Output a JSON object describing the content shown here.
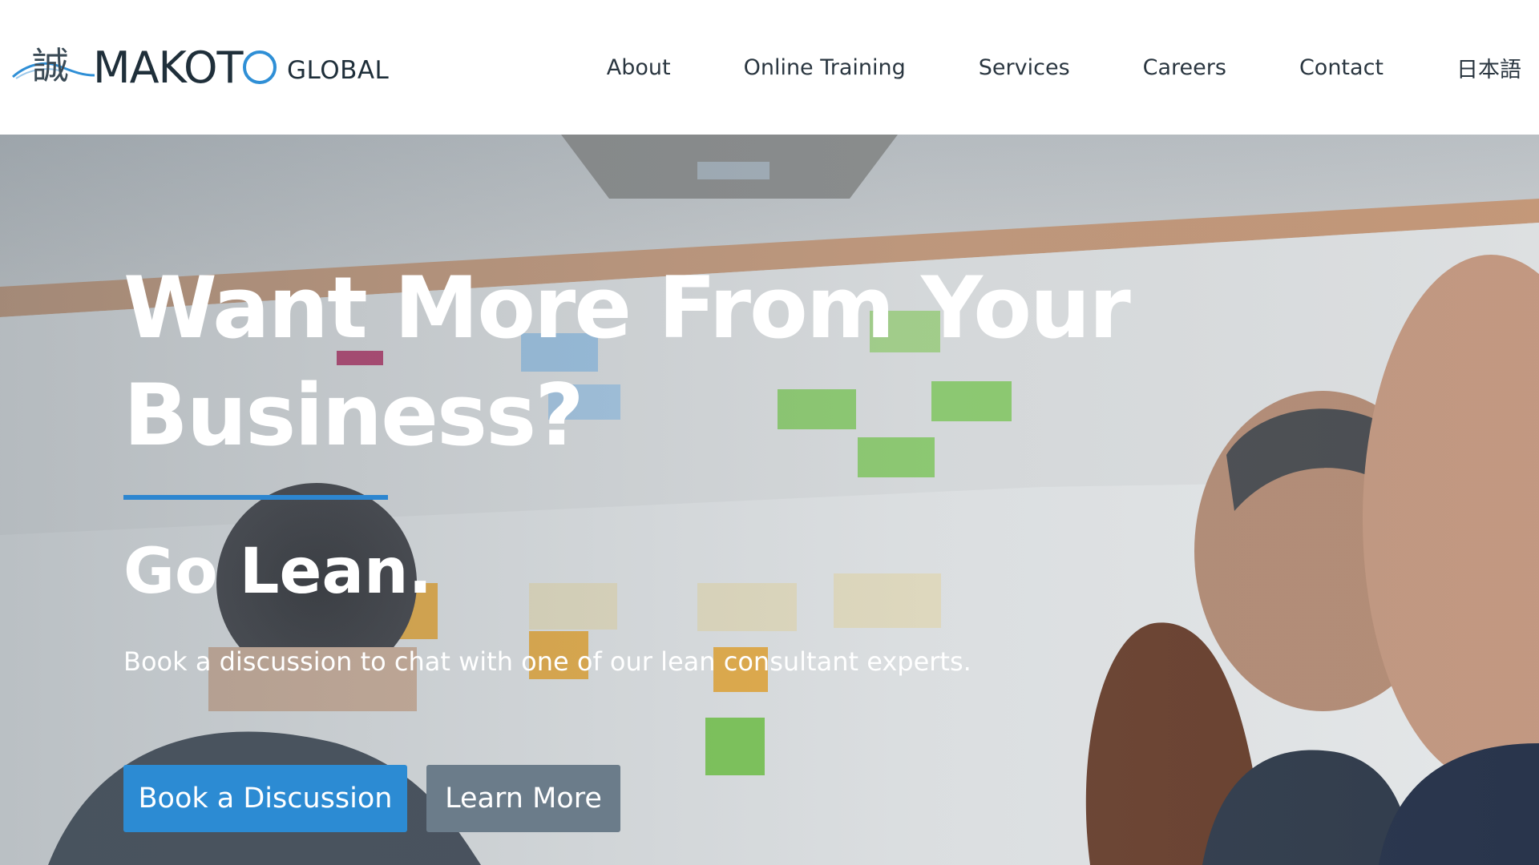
{
  "header": {
    "logo": {
      "kanji": "誠",
      "wordmark": "MAKOT",
      "suffix": "GLOBAL",
      "accent_color": "#2f8fd6"
    },
    "nav": [
      {
        "label": "About"
      },
      {
        "label": "Online Training"
      },
      {
        "label": "Services"
      },
      {
        "label": "Careers"
      },
      {
        "label": "Contact"
      },
      {
        "label": "日本語"
      }
    ]
  },
  "hero": {
    "title_line1": "Want More From Your",
    "title_line2": "Business?",
    "subtitle": "Go Lean.",
    "description": "Book a discussion to chat with one of our lean consultant experts.",
    "primary_button": "Book a Discussion",
    "secondary_button": "Learn More",
    "colors": {
      "accent_rule": "#2d86d0",
      "primary_button": "#2c8bd3",
      "secondary_button": "#6b7c8a"
    }
  }
}
